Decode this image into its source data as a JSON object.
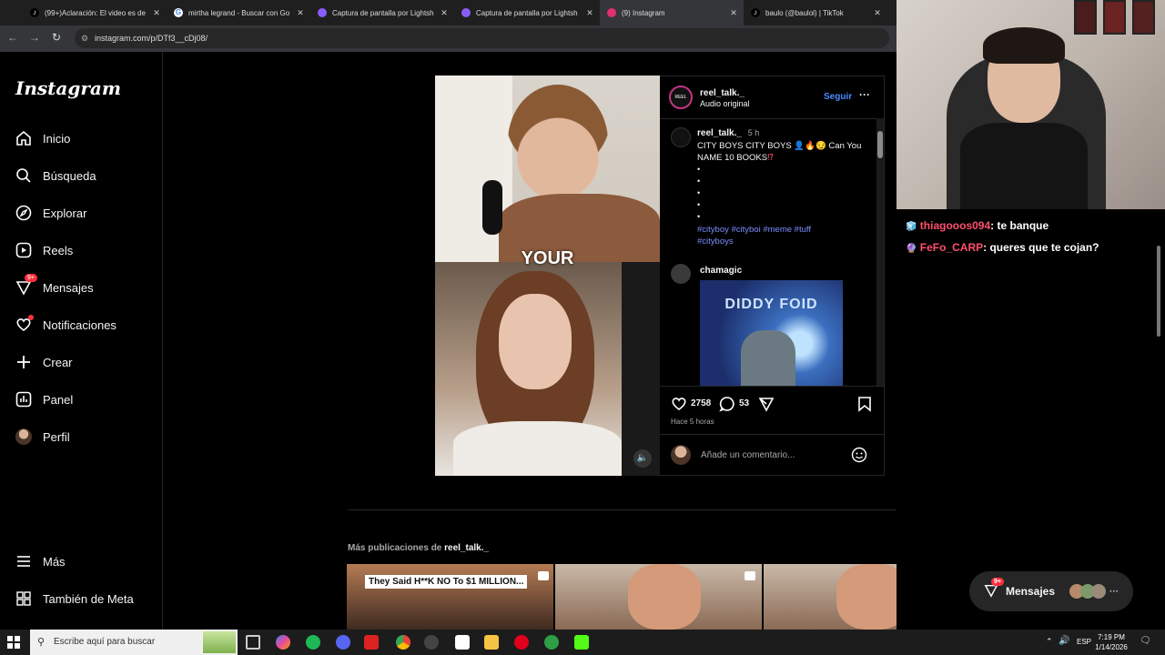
{
  "browser": {
    "tabs": [
      {
        "label": "(99+)Aclaración: El video es de",
        "icon": "tiktok-icon",
        "active": false
      },
      {
        "label": "mirtha legrand - Buscar con Go",
        "icon": "google-icon",
        "active": false
      },
      {
        "label": "Captura de pantalla por Lightsh",
        "icon": "lightshot-icon",
        "active": false
      },
      {
        "label": "Captura de pantalla por Lightsh",
        "icon": "lightshot-icon",
        "active": false
      },
      {
        "label": "(9) Instagram",
        "icon": "instagram-icon",
        "active": true
      },
      {
        "label": "baulo (@baulol) | TikTok",
        "icon": "tiktok-icon",
        "active": false
      }
    ],
    "url": "instagram.com/p/DTf3__cDj08/"
  },
  "instagram": {
    "logo": "Instagram",
    "nav": [
      {
        "label": "Inicio",
        "icon": "home-icon"
      },
      {
        "label": "Búsqueda",
        "icon": "search-icon"
      },
      {
        "label": "Explorar",
        "icon": "compass-icon"
      },
      {
        "label": "Reels",
        "icon": "reels-icon"
      },
      {
        "label": "Mensajes",
        "icon": "messenger-icon",
        "badge": "9+"
      },
      {
        "label": "Notificaciones",
        "icon": "heart-icon"
      },
      {
        "label": "Crear",
        "icon": "plus-icon"
      },
      {
        "label": "Panel",
        "icon": "chart-icon"
      },
      {
        "label": "Perfil",
        "icon": "avatar-icon"
      }
    ],
    "nav_bottom": [
      {
        "label": "Más",
        "icon": "menu-icon"
      },
      {
        "label": "También de Meta",
        "icon": "meta-grid-icon"
      }
    ],
    "post": {
      "media_caption": "YOUR",
      "author": "reel_talk._",
      "audio": "Audio original",
      "follow_label": "Seguir",
      "caption_author": "reel_talk._",
      "caption_time": "5 h",
      "caption_text_1": "CITY BOYS CITY BOYS",
      "caption_text_2": "Can You",
      "caption_text_3": "NAME 10 BOOKS",
      "bullets": [
        "•",
        "•",
        "•",
        "•",
        "•"
      ],
      "hashtags_1": "#cityboy #cityboi #meme #tuff",
      "hashtags_2": "#cityboys",
      "comment_author": "chamagic",
      "comment_image_text": "DIDDY FOID",
      "likes": "2758",
      "comments": "53",
      "timestamp": "Hace 5 horas",
      "comment_placeholder": "Añade un comentario..."
    },
    "more_posts": {
      "prefix": "Más publicaciones de",
      "user": "reel_talk._",
      "thumb1_text": "They Said H**K NO To $1 MILLION..."
    },
    "messages_pill": "Mensajes",
    "messages_pill_badge": "9+"
  },
  "stream_chat": [
    {
      "user": "thiagooos094",
      "text": ": te banque",
      "color": "#ff4f6d"
    },
    {
      "user": "FeFo_CARP",
      "text": ": queres que te cojan?",
      "color": "#ff4f6d"
    }
  ],
  "taskbar": {
    "search_placeholder": "Escribe aquí para buscar",
    "language": "ESP",
    "time": "7:19 PM",
    "date": "1/14/2026"
  }
}
